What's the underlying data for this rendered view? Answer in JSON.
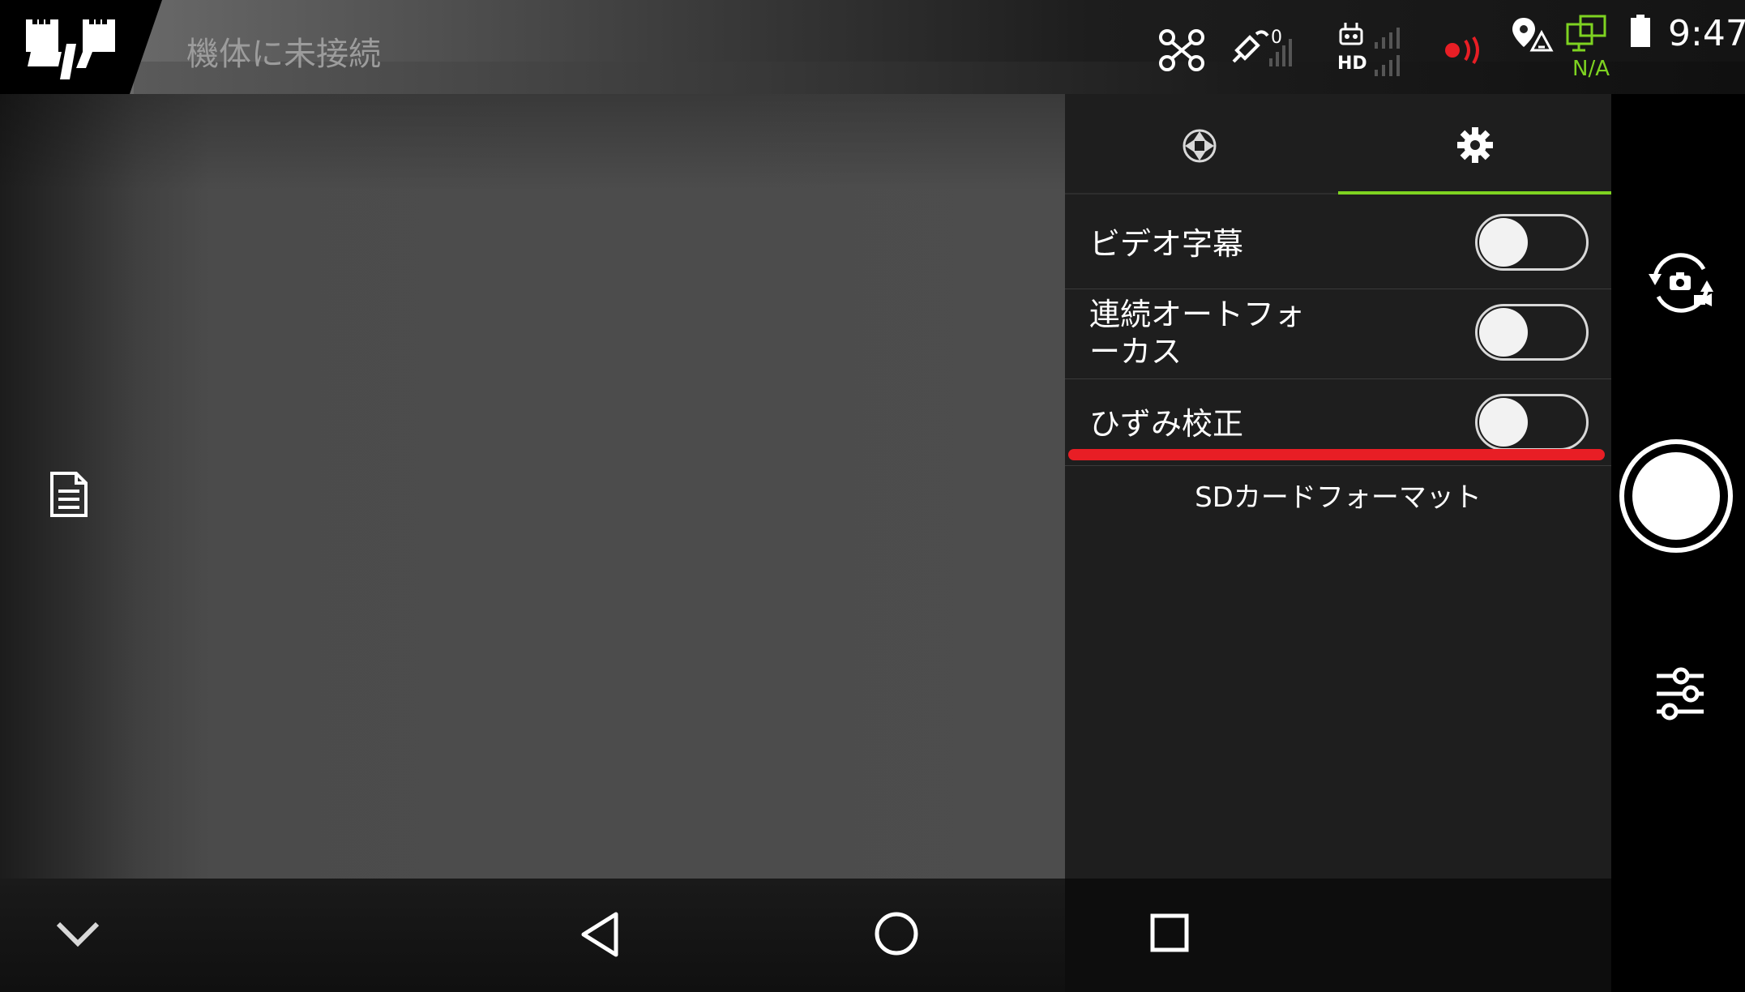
{
  "status_bar": {
    "connection_text": "機体に未接続",
    "time": "9:47",
    "gps_count": "0",
    "video_link_label": "HD",
    "na_text": "N/A",
    "logo_text": "dji",
    "icons": [
      "aircraft-icon",
      "satellite-icon",
      "remote-controller-icon",
      "rc-signal-icon",
      "video-signal-icon",
      "record-signal-icon",
      "map-pin-icon",
      "screen-cast-icon",
      "battery-icon"
    ]
  },
  "settings_panel": {
    "tabs": [
      {
        "name": "camera-tab",
        "icon": "aperture-icon",
        "active": false
      },
      {
        "name": "settings-tab",
        "icon": "gear-icon",
        "active": true
      }
    ],
    "rows": [
      {
        "label": "ビデオ字幕",
        "enabled": false
      },
      {
        "label_line1": "連続オートフォ",
        "label_line2": "ーカス",
        "enabled": false
      },
      {
        "label": "ひずみ校正",
        "enabled": false
      }
    ],
    "sd_format_label": "SDカードフォーマット",
    "accent_color": "#7ed321",
    "highlight_color": "#e81e25"
  },
  "right_bar": {
    "icons": [
      "camera-switch-icon",
      "shutter-button",
      "adjust-sliders-icon"
    ]
  },
  "nav_bar": {
    "icons": [
      "chevron-down-icon",
      "back-icon",
      "home-icon",
      "recents-icon"
    ]
  },
  "left_rail": {
    "icons": [
      "document-icon"
    ]
  }
}
